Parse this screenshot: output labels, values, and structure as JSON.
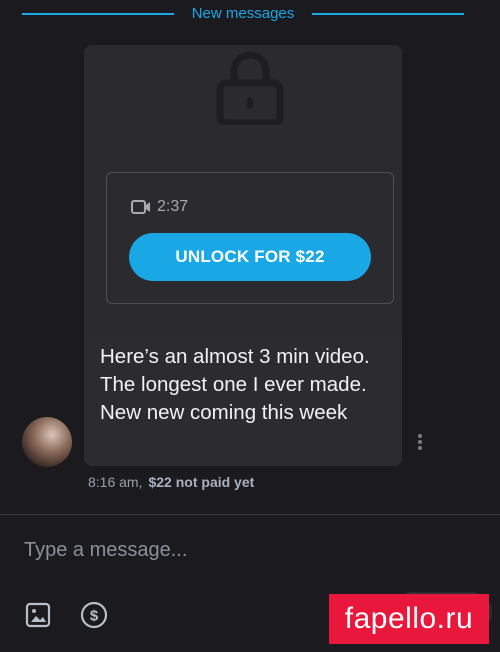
{
  "divider": {
    "label": "New messages"
  },
  "message": {
    "video_duration": "2:37",
    "unlock_label": "UNLOCK FOR $22",
    "text": "Here’s an almost 3 min video. The longest one I ever made. New new coming this week",
    "time": "8:16 am,",
    "price_status": "$22 not paid yet"
  },
  "composer": {
    "placeholder": "Type a message..."
  },
  "watermark": "fapello.ru",
  "colors": {
    "accent": "#1aa7e6",
    "background": "#1b1b1f",
    "bubble": "#2b2b30",
    "watermark": "#e8173b"
  },
  "icons": [
    "lock-icon",
    "video-camera-icon",
    "more-vert-icon",
    "image-icon",
    "dollar-circle-icon"
  ]
}
